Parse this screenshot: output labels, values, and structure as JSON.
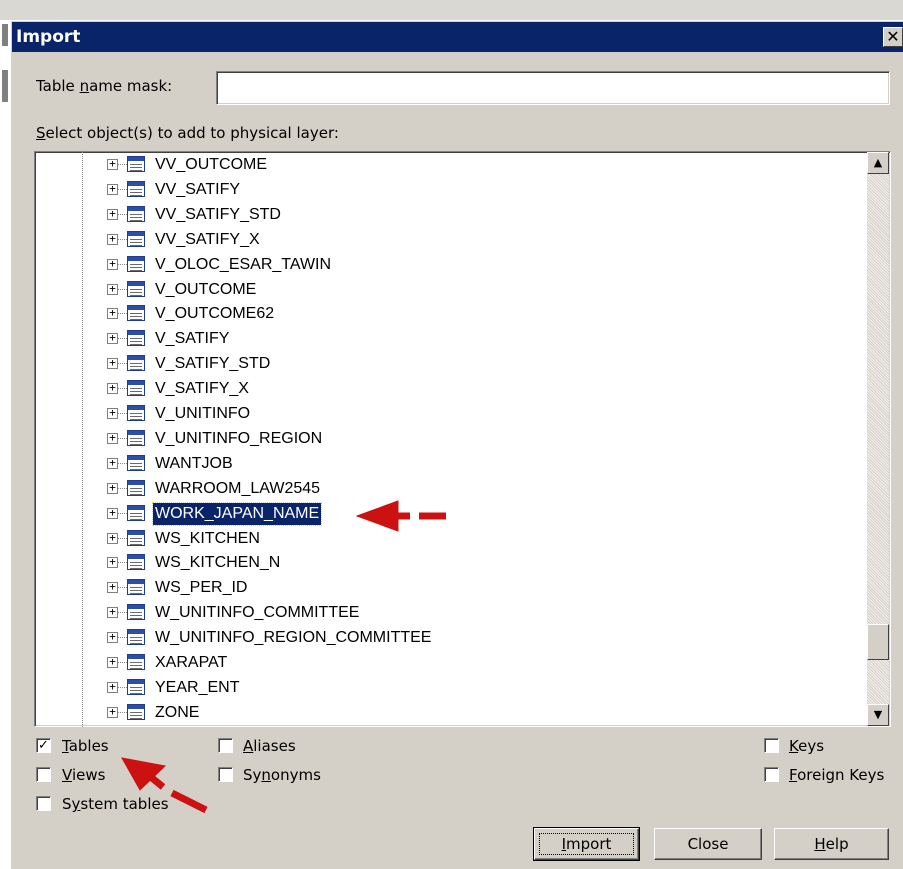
{
  "window": {
    "title": "Import",
    "close_glyph": "✕"
  },
  "mask": {
    "label_pre": "Table ",
    "label_u": "n",
    "label_post": "ame mask:",
    "value": ""
  },
  "select_label": {
    "u": "S",
    "rest": "elect object(s) to add to physical layer:"
  },
  "tree": {
    "items": [
      {
        "label": "VV_OUTCOME"
      },
      {
        "label": "VV_SATIFY"
      },
      {
        "label": "VV_SATIFY_STD"
      },
      {
        "label": "VV_SATIFY_X"
      },
      {
        "label": "V_OLOC_ESAR_TAWIN"
      },
      {
        "label": "V_OUTCOME"
      },
      {
        "label": "V_OUTCOME62"
      },
      {
        "label": "V_SATIFY"
      },
      {
        "label": "V_SATIFY_STD"
      },
      {
        "label": "V_SATIFY_X"
      },
      {
        "label": "V_UNITINFO"
      },
      {
        "label": "V_UNITINFO_REGION"
      },
      {
        "label": "WANTJOB"
      },
      {
        "label": "WARROOM_LAW2545"
      },
      {
        "label": "WORK_JAPAN_NAME",
        "selected": true
      },
      {
        "label": "WS_KITCHEN"
      },
      {
        "label": "WS_KITCHEN_N"
      },
      {
        "label": "WS_PER_ID"
      },
      {
        "label": "W_UNITINFO_COMMITTEE"
      },
      {
        "label": "W_UNITINFO_REGION_COMMITTEE"
      },
      {
        "label": "XARAPAT"
      },
      {
        "label": "YEAR_ENT"
      },
      {
        "label": "ZONE"
      }
    ]
  },
  "checkboxes": {
    "tables": {
      "u": "T",
      "rest": "ables",
      "checked": true
    },
    "views": {
      "u": "V",
      "rest": "iews",
      "checked": false
    },
    "system_tables": {
      "pre": "S",
      "u": "y",
      "rest": "stem tables",
      "checked": false
    },
    "aliases": {
      "u": "A",
      "rest": "liases",
      "checked": false
    },
    "synonyms": {
      "pre": "Sy",
      "u": "n",
      "rest": "onyms",
      "checked": false
    },
    "keys": {
      "u": "K",
      "rest": "eys",
      "checked": false
    },
    "foreign_keys": {
      "u": "F",
      "rest": "oreign Keys",
      "checked": false
    }
  },
  "buttons": {
    "import": {
      "u": "I",
      "rest": "mport"
    },
    "close": {
      "label": "Close"
    },
    "help": {
      "u": "H",
      "rest": "elp"
    }
  },
  "colors": {
    "annotation_arrow": "#cc1111",
    "selection": "#0a246a",
    "title_bar": "#0a246a"
  }
}
